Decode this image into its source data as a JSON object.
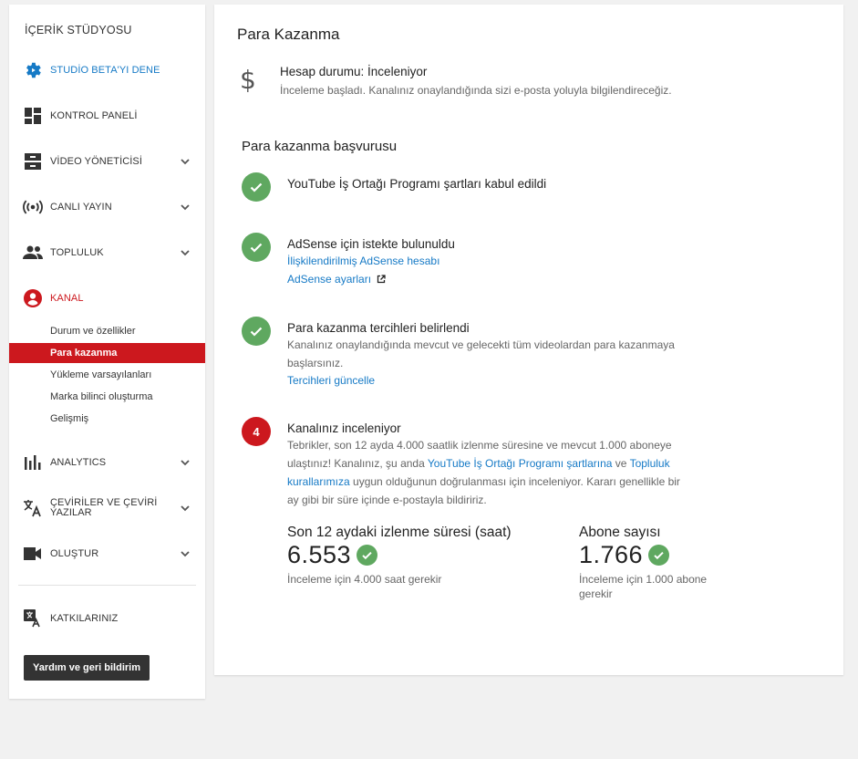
{
  "sidebar": {
    "studio_title": "İÇERİK STÜDYOSU",
    "beta": "STUDİO BETA'YI DENE",
    "dashboard": "KONTROL PANELİ",
    "video_manager": "VİDEO YÖNETİCİSİ",
    "live": "CANLI YAYIN",
    "community": "TOPLULUK",
    "channel": "KANAL",
    "channel_sub": [
      "Durum ve özellikler",
      "Para kazanma",
      "Yükleme varsayılanları",
      "Marka bilinci oluşturma",
      "Gelişmiş"
    ],
    "analytics": "ANALYTICS",
    "translations_line1": "ÇEVİRİLER VE ÇEVİRİ",
    "translations_line2": "YAZILAR",
    "create": "OLUŞTUR",
    "contributions": "KATKILARINIZ",
    "help_button": "Yardım ve geri bildirim"
  },
  "main": {
    "title": "Para Kazanma",
    "account_status": "Hesap durumu: İnceleniyor",
    "account_desc": "İnceleme başladı. Kanalınız onaylandığında sizi e-posta yoluyla bilgilendireceğiz.",
    "application_title": "Para kazanma başvurusu",
    "step1_title": "YouTube İş Ortağı Programı şartları kabul edildi",
    "step2_title": "AdSense için istekte bulunuldu",
    "step2_link1": "İlişkilendirilmiş AdSense hesabı",
    "step2_link2": "AdSense ayarları",
    "step3_title": "Para kazanma tercihleri belirlendi",
    "step3_line1": "Kanalınız onaylandığında mevcut ve gelecekti tüm videolardan para kazanmaya",
    "step3_line2": "başlarsınız.",
    "step3_link": "Tercihleri güncelle",
    "step4_number": "4",
    "step4_title": "Kanalınız inceleniyor",
    "step4_line1": "Tebrikler, son 12 ayda 4.000 saatlik izlenme süresine ve mevcut 1.000 aboneye",
    "step4_line2_pre": "ulaştınız! Kanalınız, şu anda ",
    "step4_link_ypp": "YouTube İş Ortağı Programı şartlarına",
    "step4_line2_mid": " ve ",
    "step4_link_community_1": "Topluluk",
    "step4_link_community_2": "kurallarımıza",
    "step4_line3_post": " uygun olduğunun doğrulanması için inceleniyor. Kararı genellikle bir",
    "step4_line4": "ay gibi bir süre içinde e-postayla bildiririz.",
    "watch_label": "Son 12 aydaki izlenme süresi (saat)",
    "watch_value": "6.553",
    "watch_note": "İnceleme için 4.000 saat gerekir",
    "subs_label": "Abone sayısı",
    "subs_value": "1.766",
    "subs_note_line1": "İnceleme için 1.000 abone",
    "subs_note_line2": "gerekir"
  },
  "colors": {
    "accent_red": "#cc181e",
    "link_blue": "#167ac6",
    "success_green": "#5fa860"
  }
}
